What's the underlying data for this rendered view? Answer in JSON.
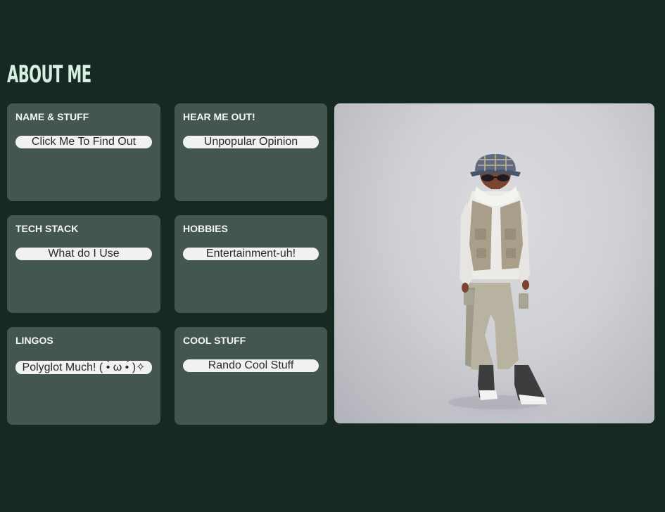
{
  "page": {
    "title": "ABOUT ME"
  },
  "cards": [
    {
      "title": "NAME & STUFF",
      "button": "Click Me To Find Out"
    },
    {
      "title": "HEAR ME OUT!",
      "button": "Unpopular Opinion"
    },
    {
      "title": "TECH STACK",
      "button": "What do I Use"
    },
    {
      "title": "HOBBIES",
      "button": "Entertainment-uh!"
    },
    {
      "title": "LINGOS",
      "button": "Polyglot Much! ( •̀ ω •́ )✧"
    },
    {
      "title": "COOL STUFF",
      "button": "Rando Cool Stuff"
    }
  ],
  "colors": {
    "background": "#162922",
    "card": "#44574f",
    "title": "#d7efe3",
    "button": "#f1f1f1"
  }
}
